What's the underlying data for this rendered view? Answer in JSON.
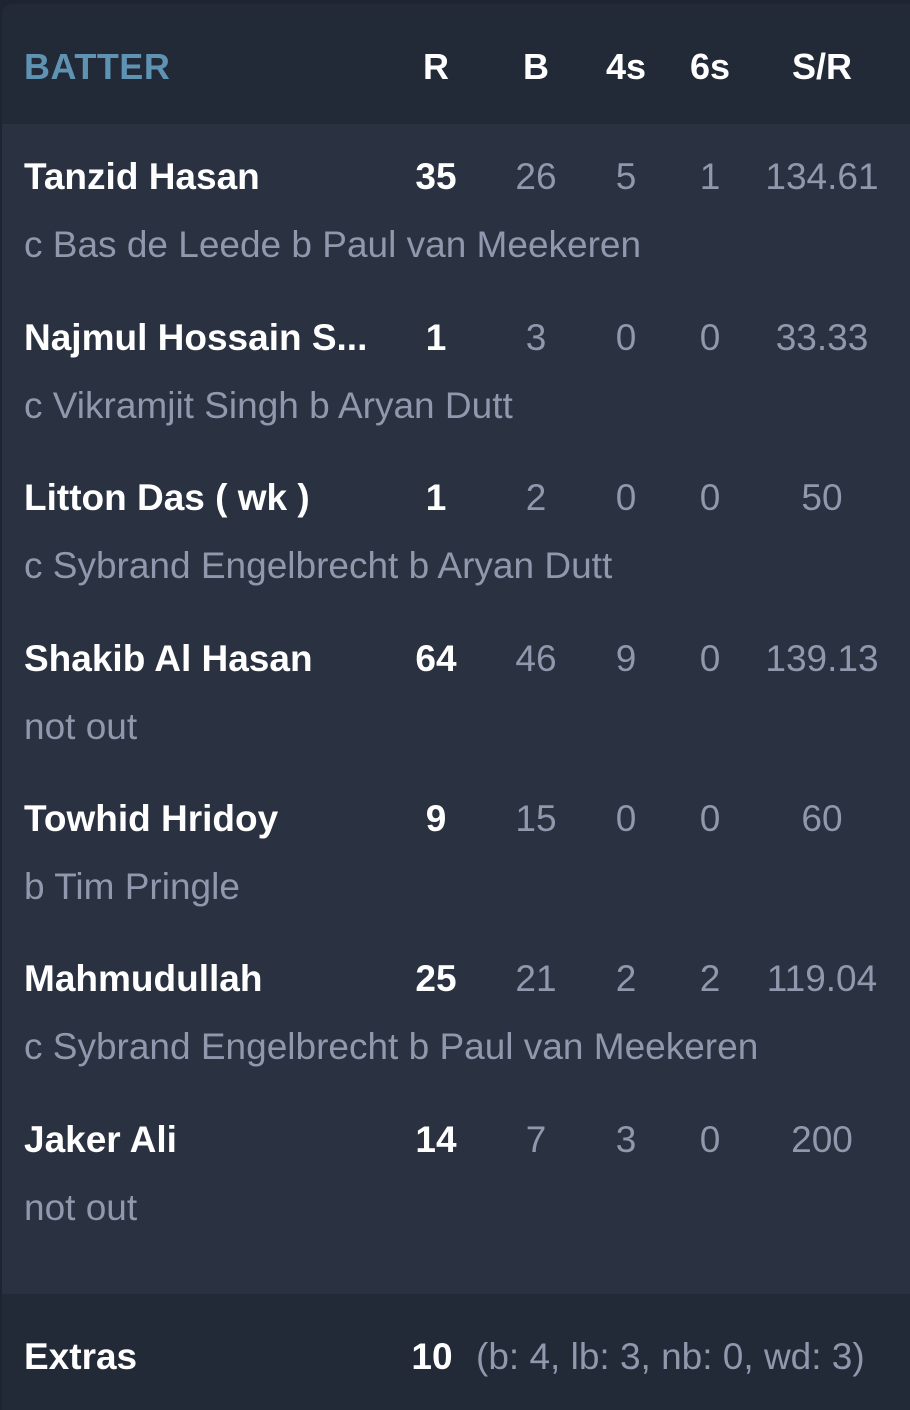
{
  "header": {
    "batter": "BATTER",
    "runs": "R",
    "balls": "B",
    "fours": "4s",
    "sixes": "6s",
    "strike_rate": "S/R"
  },
  "batters": [
    {
      "name": "Tanzid Hasan",
      "dismissal": "c Bas de Leede b Paul van Meekeren",
      "runs": "35",
      "balls": "26",
      "fours": "5",
      "sixes": "1",
      "sr": "134.61"
    },
    {
      "name": "Najmul Hossain S...",
      "dismissal": "c Vikramjit Singh b Aryan Dutt",
      "runs": "1",
      "balls": "3",
      "fours": "0",
      "sixes": "0",
      "sr": "33.33"
    },
    {
      "name": "Litton Das ( wk )",
      "dismissal": "c Sybrand Engelbrecht b Aryan Dutt",
      "runs": "1",
      "balls": "2",
      "fours": "0",
      "sixes": "0",
      "sr": "50"
    },
    {
      "name": "Shakib Al Hasan",
      "dismissal": "not out",
      "runs": "64",
      "balls": "46",
      "fours": "9",
      "sixes": "0",
      "sr": "139.13"
    },
    {
      "name": "Towhid Hridoy",
      "dismissal": "b Tim Pringle",
      "runs": "9",
      "balls": "15",
      "fours": "0",
      "sixes": "0",
      "sr": "60"
    },
    {
      "name": "Mahmudullah",
      "dismissal": "c Sybrand Engelbrecht b Paul van Meekeren",
      "runs": "25",
      "balls": "21",
      "fours": "2",
      "sixes": "2",
      "sr": "119.04"
    },
    {
      "name": "Jaker Ali",
      "dismissal": "not out",
      "runs": "14",
      "balls": "7",
      "fours": "3",
      "sixes": "0",
      "sr": "200"
    }
  ],
  "extras": {
    "label": "Extras",
    "total": "10",
    "detail": "(b: 4, lb: 3, nb: 0, wd: 3)"
  },
  "colors": {
    "background": "#1e2430",
    "card": "#2a3140",
    "header_bg": "#222937",
    "accent": "#5f93b3",
    "primary_text": "#ffffff",
    "secondary_text": "#8f98ad"
  }
}
